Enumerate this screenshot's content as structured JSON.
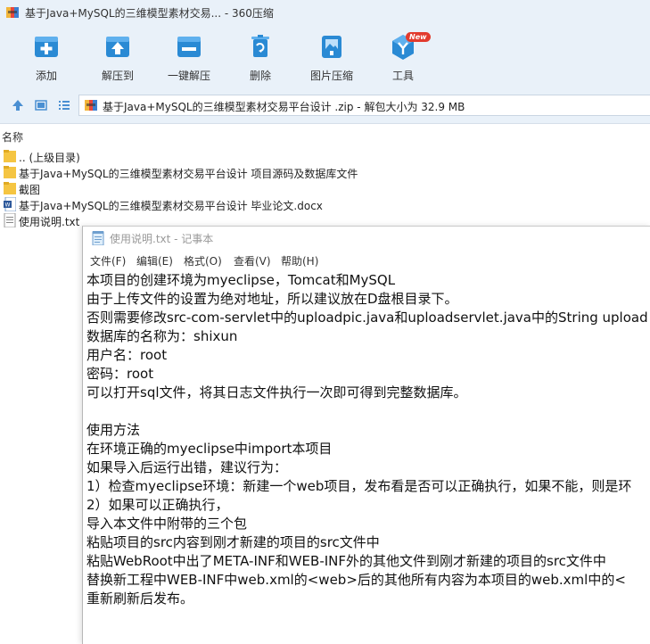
{
  "window": {
    "title": "基于Java+MySQL的三维模型素材交易... - 360压缩"
  },
  "toolbar": {
    "items": [
      {
        "label": "添加",
        "icon": "add-icon"
      },
      {
        "label": "解压到",
        "icon": "extract-to-icon"
      },
      {
        "label": "一键解压",
        "icon": "one-click-extract-icon"
      },
      {
        "label": "删除",
        "icon": "delete-icon"
      },
      {
        "label": "图片压缩",
        "icon": "image-compress-icon"
      },
      {
        "label": "工具",
        "icon": "tools-icon",
        "badge": "New"
      }
    ]
  },
  "addressbar": {
    "path": "基于Java+MySQL的三维模型素材交易平台设计 .zip - 解包大小为 32.9 MB"
  },
  "filelist": {
    "header": "名称",
    "items": [
      {
        "name": ".. (上级目录)",
        "type": "folder"
      },
      {
        "name": "基于Java+MySQL的三维模型素材交易平台设计 项目源码及数据库文件",
        "type": "folder"
      },
      {
        "name": "截图",
        "type": "folder"
      },
      {
        "name": "基于Java+MySQL的三维模型素材交易平台设计 毕业论文.docx",
        "type": "docx"
      },
      {
        "name": "使用说明.txt",
        "type": "txt"
      }
    ]
  },
  "notepad": {
    "title": "使用说明.txt - 记事本",
    "menu": [
      "文件(F)",
      "编辑(E)",
      "格式(O)",
      "查看(V)",
      "帮助(H)"
    ],
    "lines": [
      "本项目的创建环境为myeclipse，Tomcat和MySQL",
      "由于上传文件的设置为绝对地址，所以建议放在D盘根目录下。",
      "否则需要修改src-com-servlet中的uploadpic.java和uploadservlet.java中的String upload",
      "数据库的名称为：shixun",
      "用户名：root",
      "密码：root",
      "可以打开sql文件，将其日志文件执行一次即可得到完整数据库。",
      "",
      "使用方法",
      "在环境正确的myeclipse中import本项目",
      "如果导入后运行出错，建议行为：",
      "1）检查myeclipse环境：新建一个web项目，发布看是否可以正确执行，如果不能，则是环",
      "2）如果可以正确执行，",
      "导入本文件中附带的三个包",
      "粘贴项目的src内容到刚才新建的项目的src文件中",
      "粘贴WebRoot中出了META-INF和WEB-INF外的其他文件到刚才新建的项目的src文件中",
      "替换新工程中WEB-INF中web.xml的<web>后的其他所有内容为本项目的web.xml中的<",
      "重新刷新后发布。"
    ]
  },
  "colors": {
    "chrome_bg": "#e9f1f9",
    "tool_blue": "#2a8ad4",
    "badge_red": "#e23b2e",
    "folder_yellow": "#f5c542"
  }
}
